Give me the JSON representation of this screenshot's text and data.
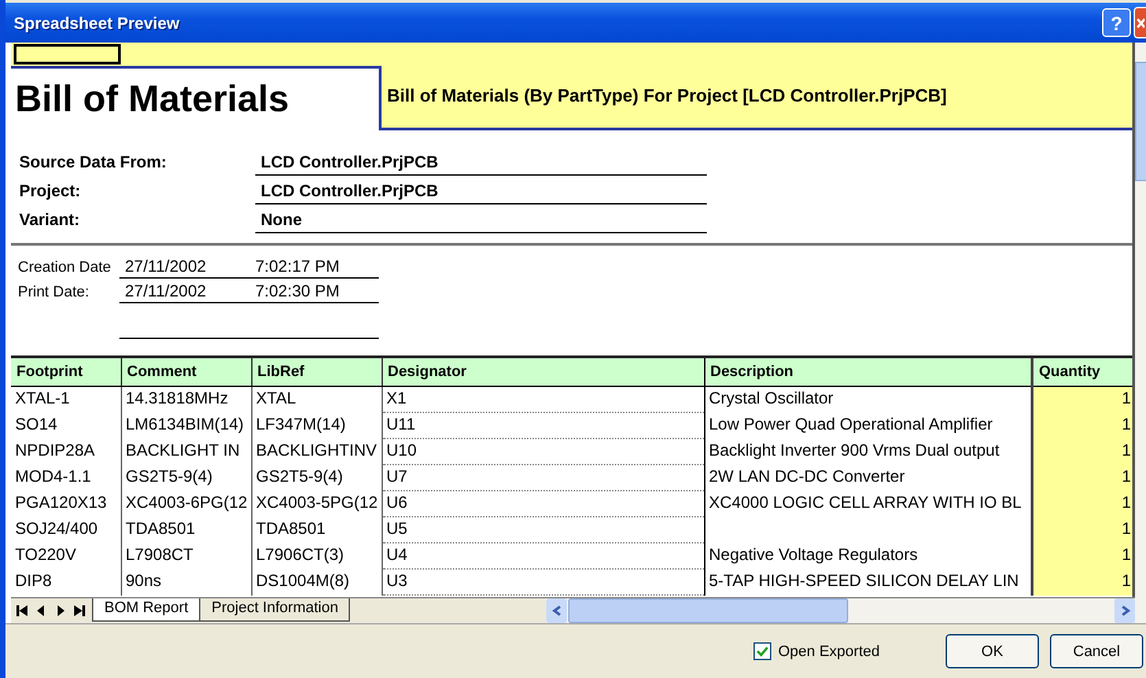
{
  "window": {
    "title": "Spreadsheet Preview",
    "help_button": "?"
  },
  "report": {
    "title": "Bill of Materials",
    "subtitle": "Bill of Materials (By PartType) For Project [LCD Controller.PrjPCB]",
    "info": [
      {
        "label": "Source Data From:",
        "value": "LCD Controller.PrjPCB"
      },
      {
        "label": "Project:",
        "value": "LCD Controller.PrjPCB"
      },
      {
        "label": "Variant:",
        "value": "None"
      }
    ],
    "dates": [
      {
        "label": "Creation Date",
        "date": "27/11/2002",
        "time": "7:02:17 PM"
      },
      {
        "label": "Print Date:",
        "date": "27/11/2002",
        "time": "7:02:30 PM"
      }
    ]
  },
  "table": {
    "columns": [
      "Footprint",
      "Comment",
      "LibRef",
      "Designator",
      "Description",
      "Quantity"
    ],
    "rows": [
      {
        "footprint": "XTAL-1",
        "comment": "14.31818MHz",
        "libref": "XTAL",
        "designator": "X1",
        "description": "Crystal Oscillator",
        "quantity": "1"
      },
      {
        "footprint": "SO14",
        "comment": "LM6134BIM(14)",
        "libref": "LF347M(14)",
        "designator": "U11",
        "description": "Low Power Quad Operational Amplifier",
        "quantity": "1"
      },
      {
        "footprint": "NPDIP28A",
        "comment": "BACKLIGHT IN",
        "libref": "BACKLIGHTINV",
        "designator": "U10",
        "description": "Backlight Inverter 900 Vrms Dual output",
        "quantity": "1"
      },
      {
        "footprint": "MOD4-1.1",
        "comment": "GS2T5-9(4)",
        "libref": "GS2T5-9(4)",
        "designator": "U7",
        "description": "2W LAN DC-DC Converter",
        "quantity": "1"
      },
      {
        "footprint": "PGA120X13",
        "comment": "XC4003-6PG(12",
        "libref": "XC4003-5PG(12",
        "designator": "U6",
        "description": "XC4000 LOGIC CELL ARRAY WITH IO BL",
        "quantity": "1"
      },
      {
        "footprint": "SOJ24/400",
        "comment": "TDA8501",
        "libref": "TDA8501",
        "designator": "U5",
        "quantity": "1"
      },
      {
        "footprint": "TO220V",
        "comment": "L7908CT",
        "libref": "L7906CT(3)",
        "designator": "U4",
        "description": "Negative Voltage Regulators",
        "quantity": "1"
      },
      {
        "footprint": "DIP8",
        "comment": "90ns",
        "libref": "DS1004M(8)",
        "designator": "U3",
        "description": "5-TAP HIGH-SPEED SILICON DELAY LIN",
        "quantity": "1"
      }
    ]
  },
  "sheet_tabs": [
    {
      "label": "BOM Report",
      "selected": true
    },
    {
      "label": "Project Information",
      "selected": false
    }
  ],
  "open_exported": {
    "label": "Open Exported",
    "checked": true
  },
  "buttons": [
    "OK",
    "Cancel"
  ]
}
